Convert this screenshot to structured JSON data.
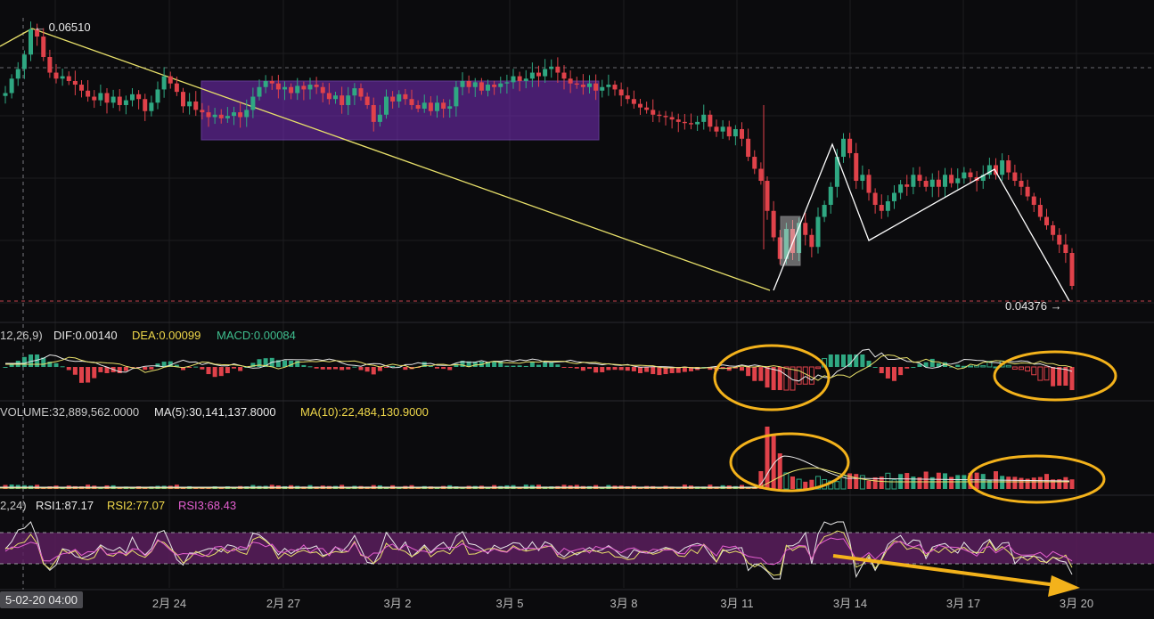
{
  "chart_data": {
    "type": "candlestick",
    "price": {
      "high_label": "← 0.06510",
      "low_label": "0.04376 →",
      "high": 0.0651,
      "low": 0.04376,
      "ylim": [
        0.0425,
        0.0668
      ],
      "closes": [
        0.0598,
        0.061,
        0.0618,
        0.063,
        0.0651,
        0.0645,
        0.0628,
        0.0615,
        0.061,
        0.0612,
        0.0608,
        0.0605,
        0.06,
        0.0595,
        0.0592,
        0.0598,
        0.059,
        0.0595,
        0.0588,
        0.0592,
        0.0597,
        0.0593,
        0.0583,
        0.059,
        0.0601,
        0.0612,
        0.0606,
        0.0599,
        0.0587,
        0.0591,
        0.0584,
        0.0582,
        0.0578,
        0.058,
        0.0577,
        0.0579,
        0.0582,
        0.0578,
        0.0584,
        0.0595,
        0.0603,
        0.0608,
        0.0606,
        0.0601,
        0.0603,
        0.0598,
        0.0604,
        0.0601,
        0.0605,
        0.0603,
        0.0598,
        0.0593,
        0.0596,
        0.0588,
        0.0596,
        0.0602,
        0.0595,
        0.0588,
        0.0574,
        0.058,
        0.0595,
        0.0591,
        0.0597,
        0.0593,
        0.0588,
        0.0585,
        0.059,
        0.0583,
        0.059,
        0.0585,
        0.0587,
        0.0603,
        0.0608,
        0.0603,
        0.0607,
        0.06,
        0.0605,
        0.0603,
        0.0606,
        0.0607,
        0.0612,
        0.0608,
        0.061,
        0.0615,
        0.0612,
        0.0618,
        0.062,
        0.0615,
        0.061,
        0.0606,
        0.0605,
        0.0603,
        0.0606,
        0.06,
        0.0603,
        0.0605,
        0.0601,
        0.0596,
        0.0593,
        0.0589,
        0.0586,
        0.0584,
        0.058,
        0.0579,
        0.0578,
        0.0576,
        0.0574,
        0.0573,
        0.0572,
        0.0574,
        0.058,
        0.057,
        0.0566,
        0.057,
        0.0562,
        0.0568,
        0.056,
        0.0545,
        0.0535,
        0.0525,
        0.05,
        0.0478,
        0.046,
        0.0485,
        0.0465,
        0.049,
        0.048,
        0.047,
        0.0495,
        0.0505,
        0.052,
        0.0545,
        0.056,
        0.0548,
        0.0525,
        0.053,
        0.0515,
        0.0505,
        0.05,
        0.0508,
        0.0515,
        0.0522,
        0.052,
        0.053,
        0.0525,
        0.052,
        0.0526,
        0.052,
        0.053,
        0.0523,
        0.0527,
        0.0532,
        0.0528,
        0.0525,
        0.053,
        0.0538,
        0.053,
        0.0542,
        0.0532,
        0.0525,
        0.052,
        0.0512,
        0.0505,
        0.0495,
        0.0488,
        0.048,
        0.0472,
        0.0465,
        0.04376
      ]
    },
    "macd": {
      "params_label": "12,26,9)",
      "dif": "DIF:0.00140",
      "dea": "DEA:0.00099",
      "macd": "MACD:0.00084"
    },
    "volume": {
      "label": "VOLUME:32,889,562.0000",
      "ma5": "MA(5):30,141,137.8000",
      "ma10": "MA(10):22,484,130.9000"
    },
    "rsi": {
      "params_label": "2,24)",
      "rsi1": "RSI1:87.17",
      "rsi2": "RSI2:77.07",
      "rsi3": "RSI3:68.43"
    },
    "x_ticks": [
      "2月 24",
      "2月 27",
      "3月 2",
      "3月 5",
      "3月 8",
      "3月 11",
      "3月 14",
      "3月 17",
      "3月 20"
    ],
    "crosshair_label": "5-02-20 04:00",
    "colors": {
      "up": "#2fa882",
      "down": "#e0424a",
      "trend": "#e8e06a",
      "zone": "#7b2fbf",
      "highlight": "#f3b21b",
      "rsi_band": "#5a1f5e"
    }
  }
}
